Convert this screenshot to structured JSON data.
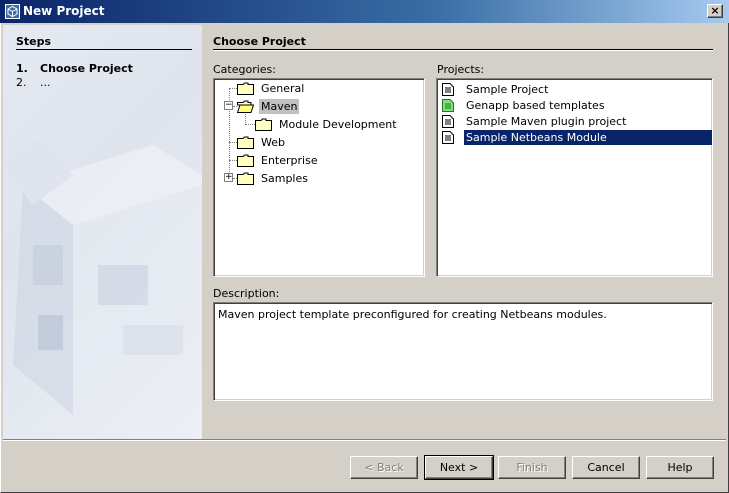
{
  "window": {
    "title": "New Project",
    "close_label": "×"
  },
  "steps": {
    "heading": "Steps",
    "items": [
      {
        "num": "1.",
        "label": "Choose Project"
      },
      {
        "num": "2.",
        "label": "..."
      }
    ]
  },
  "main": {
    "heading": "Choose Project",
    "categories_label": "Categories:",
    "projects_label": "Projects:",
    "description_label": "Description:",
    "categories": [
      {
        "label": "General"
      },
      {
        "label": "Maven",
        "expander": "−"
      },
      {
        "label": "Module Development"
      },
      {
        "label": "Web"
      },
      {
        "label": "Enterprise"
      },
      {
        "label": "Samples",
        "expander": "+"
      }
    ],
    "selected_category": "Maven",
    "projects": [
      {
        "label": "Sample Project",
        "icon": "document-icon"
      },
      {
        "label": "Genapp based templates",
        "icon": "green-document-icon"
      },
      {
        "label": "Sample Maven plugin project",
        "icon": "document-icon"
      },
      {
        "label": "Sample Netbeans Module",
        "icon": "document-icon"
      }
    ],
    "selected_project": "Sample Netbeans Module",
    "description": "Maven project template preconfigured for creating Netbeans modules."
  },
  "buttons": {
    "back": "< Back",
    "next": "Next >",
    "finish": "Finish",
    "cancel": "Cancel",
    "help": "Help"
  },
  "colors": {
    "title_bar": "#0a246a",
    "selection": "#0a246a",
    "dialog_bg": "#d4d0c8"
  }
}
